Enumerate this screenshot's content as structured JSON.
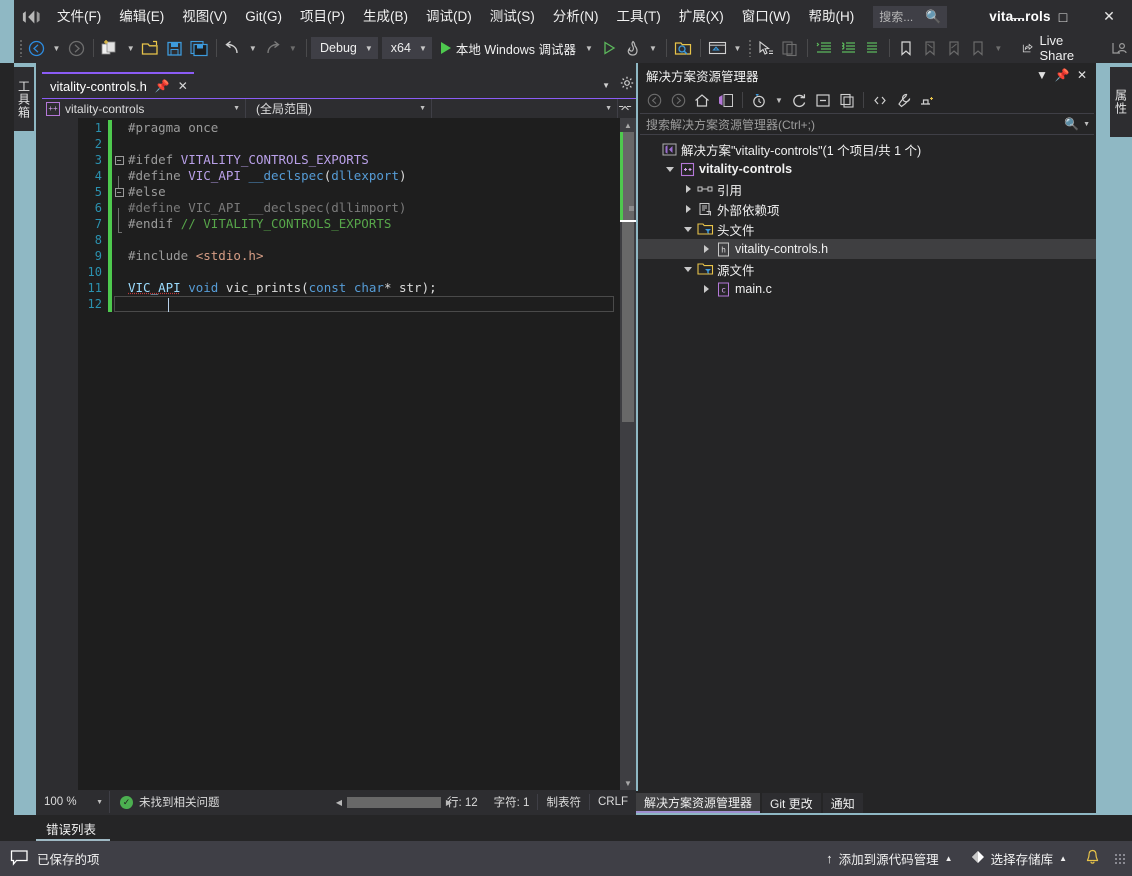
{
  "window": {
    "solution_title": "vita...rols",
    "minimize": "—",
    "maximize": "□",
    "close": "✕"
  },
  "menu": {
    "items": [
      {
        "label": "文件(F)",
        "name": "menu-file"
      },
      {
        "label": "编辑(E)",
        "name": "menu-edit"
      },
      {
        "label": "视图(V)",
        "name": "menu-view"
      },
      {
        "label": "Git(G)",
        "name": "menu-git"
      },
      {
        "label": "项目(P)",
        "name": "menu-project"
      },
      {
        "label": "生成(B)",
        "name": "menu-build"
      },
      {
        "label": "调试(D)",
        "name": "menu-debug"
      },
      {
        "label": "测试(S)",
        "name": "menu-test"
      },
      {
        "label": "分析(N)",
        "name": "menu-analyze"
      },
      {
        "label": "工具(T)",
        "name": "menu-tools"
      },
      {
        "label": "扩展(X)",
        "name": "menu-extensions"
      },
      {
        "label": "窗口(W)",
        "name": "menu-window"
      },
      {
        "label": "帮助(H)",
        "name": "menu-help"
      }
    ],
    "search_placeholder": "搜索..."
  },
  "toolbar": {
    "configuration": "Debug",
    "platform": "x64",
    "debug_target": "本地 Windows 调试器",
    "live_share": "Live Share"
  },
  "vertical_tabs": {
    "left": "工具箱",
    "right": "属性"
  },
  "editor": {
    "tab_label": "vitality-controls.h",
    "nav_project": "vitality-controls",
    "nav_scope": "(全局范围)",
    "nav_member": "",
    "lines": [
      {
        "n": "1",
        "mod": true,
        "fold": "none",
        "tokens": [
          {
            "t": "#pragma once",
            "c": "k-pre"
          }
        ]
      },
      {
        "n": "2",
        "mod": true,
        "fold": "none",
        "tokens": []
      },
      {
        "n": "3",
        "mod": true,
        "fold": "open",
        "tokens": [
          {
            "t": "#ifdef ",
            "c": "k-pre"
          },
          {
            "t": "VITALITY_CONTROLS_EXPORTS",
            "c": "k-macro"
          }
        ]
      },
      {
        "n": "4",
        "mod": true,
        "fold": "mid",
        "tokens": [
          {
            "t": "#define ",
            "c": "k-pre"
          },
          {
            "t": "VIC_API",
            "c": "k-macro"
          },
          {
            "t": " ",
            "c": "k-plain"
          },
          {
            "t": "__declspec",
            "c": "k-kw"
          },
          {
            "t": "(",
            "c": "k-punct"
          },
          {
            "t": "dllexport",
            "c": "k-kw"
          },
          {
            "t": ")",
            "c": "k-punct"
          }
        ]
      },
      {
        "n": "5",
        "mod": true,
        "fold": "open",
        "tokens": [
          {
            "t": "#else",
            "c": "k-pre"
          }
        ]
      },
      {
        "n": "6",
        "mod": true,
        "fold": "mid",
        "tokens": [
          {
            "t": "#define VIC_API __declspec(dllimport)",
            "c": "k-dim"
          }
        ]
      },
      {
        "n": "7",
        "mod": true,
        "fold": "end",
        "tokens": [
          {
            "t": "#endif ",
            "c": "k-pre"
          },
          {
            "t": "// VITALITY_CONTROLS_EXPORTS",
            "c": "k-cmt"
          }
        ]
      },
      {
        "n": "8",
        "mod": true,
        "fold": "none",
        "tokens": []
      },
      {
        "n": "9",
        "mod": true,
        "fold": "none",
        "tokens": [
          {
            "t": "#include ",
            "c": "k-pre"
          },
          {
            "t": "<stdio.h>",
            "c": "k-str"
          }
        ]
      },
      {
        "n": "10",
        "mod": true,
        "fold": "none",
        "tokens": []
      },
      {
        "n": "11",
        "mod": true,
        "fold": "none",
        "tokens": [
          {
            "t": "VIC_API",
            "c": "k-id sq"
          },
          {
            "t": " ",
            "c": "k-plain"
          },
          {
            "t": "void",
            "c": "k-kw"
          },
          {
            "t": " ",
            "c": "k-plain"
          },
          {
            "t": "vic_prints",
            "c": "k-plain"
          },
          {
            "t": "(",
            "c": "k-punct"
          },
          {
            "t": "const",
            "c": "k-kw"
          },
          {
            "t": " ",
            "c": "k-plain"
          },
          {
            "t": "char",
            "c": "k-kw"
          },
          {
            "t": "* str);",
            "c": "k-punct"
          }
        ]
      },
      {
        "n": "12",
        "mod": true,
        "fold": "none",
        "tokens": []
      }
    ],
    "status": {
      "zoom": "100 %",
      "issues": "未找到相关问题",
      "line": "行: 12",
      "column": "字符: 1",
      "tabs": "制表符",
      "line_endings": "CRLF"
    }
  },
  "solution_explorer": {
    "title": "解决方案资源管理器",
    "search_placeholder": "搜索解决方案资源管理器(Ctrl+;)",
    "tree": [
      {
        "level": 0,
        "twisty": "none",
        "icon": "solution-icon",
        "label": "解决方案\"vitality-controls\"(1 个项目/共 1 个)",
        "bold": false,
        "selected": false,
        "name": "tree-item-solution"
      },
      {
        "level": 1,
        "twisty": "down",
        "icon": "cpp-project-icon",
        "label": "vitality-controls",
        "bold": true,
        "selected": false,
        "name": "tree-item-project"
      },
      {
        "level": 2,
        "twisty": "right",
        "icon": "references-icon",
        "label": "引用",
        "bold": false,
        "selected": false,
        "name": "tree-item-references"
      },
      {
        "level": 2,
        "twisty": "right",
        "icon": "external-deps-icon",
        "label": "外部依赖项",
        "bold": false,
        "selected": false,
        "name": "tree-item-external-dependencies"
      },
      {
        "level": 2,
        "twisty": "down",
        "icon": "folder-filter-icon",
        "label": "头文件",
        "bold": false,
        "selected": false,
        "name": "tree-item-header-files"
      },
      {
        "level": 3,
        "twisty": "right",
        "icon": "h-file-icon",
        "label": "vitality-controls.h",
        "bold": false,
        "selected": true,
        "name": "tree-item-vitality-controls-h"
      },
      {
        "level": 2,
        "twisty": "down",
        "icon": "folder-filter-icon",
        "label": "源文件",
        "bold": false,
        "selected": false,
        "name": "tree-item-source-files"
      },
      {
        "level": 3,
        "twisty": "right",
        "icon": "c-file-icon",
        "label": "main.c",
        "bold": false,
        "selected": false,
        "name": "tree-item-main-c"
      }
    ],
    "bottom_tabs": [
      {
        "label": "解决方案资源管理器",
        "active": true,
        "name": "tab-solution-explorer"
      },
      {
        "label": "Git 更改",
        "active": false,
        "name": "tab-git-changes"
      },
      {
        "label": "通知",
        "active": false,
        "name": "tab-notifications"
      }
    ]
  },
  "bottom_dock": {
    "error_list_tab": "错误列表"
  },
  "statusbar": {
    "saved_item": "已保存的项",
    "add_source_control": "添加到源代码管理",
    "select_repository": "选择存储库",
    "notification_icon": "bell-icon"
  },
  "colors": {
    "accent_purple": "#8b5cf6",
    "status_bar": "#3f3f46",
    "editor_bg": "#1e1e1e",
    "chrome_bg": "#2d2d30",
    "panel_bg": "#252526",
    "desktop": "#8fb8c4",
    "modified_green": "#4ec94e"
  }
}
